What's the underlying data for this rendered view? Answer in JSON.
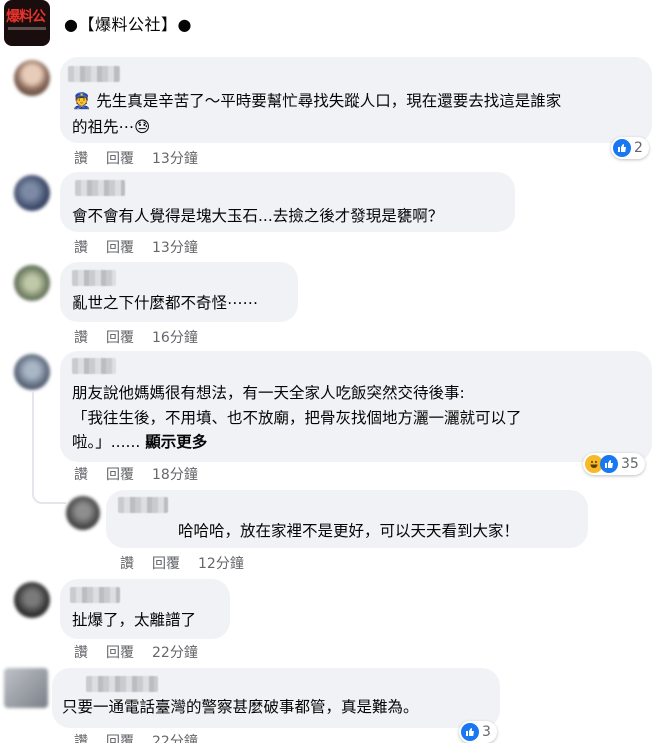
{
  "page": {
    "logo_text": "爆料公",
    "name": "●【爆料公社】●"
  },
  "actions": {
    "like": "讚",
    "reply": "回覆"
  },
  "comments": [
    {
      "lines": [
        "👮 先生真是辛苦了～平時要幫忙尋找失蹤人口，現在還要去找這是誰家",
        "的祖先⋯😓"
      ],
      "time": "13分鐘",
      "reaction_count": "2"
    },
    {
      "lines": [
        "會不會有人覺得是塊大玉石...去撿之後才發現是甕啊？"
      ],
      "time": "13分鐘"
    },
    {
      "lines": [
        "亂世之下什麼都不奇怪⋯⋯"
      ],
      "time": "16分鐘"
    },
    {
      "lines": [
        "朋友說他媽媽很有想法，有一天全家人吃飯突然交待後事:",
        "「我往生後，不用墳、也不放廟，把骨灰找個地方灑一灑就可以了",
        "啦。」......"
      ],
      "more": "顯示更多",
      "time": "18分鐘",
      "reaction_count": "35"
    },
    {
      "lines": [
        "哈哈哈，放在家裡不是更好，可以天天看到大家！"
      ],
      "time": "12分鐘"
    },
    {
      "lines": [
        "扯爆了，太離譜了"
      ],
      "time": "22分鐘"
    },
    {
      "lines": [
        "只要一通電話臺灣的警察甚麼破事都管，真是難為。"
      ],
      "time": "22分鐘",
      "reaction_count": "3"
    }
  ]
}
